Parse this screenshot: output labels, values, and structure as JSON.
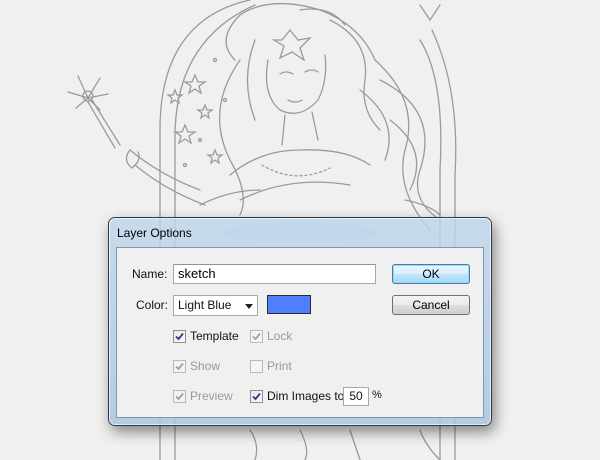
{
  "dialog": {
    "title": "Layer Options",
    "name_label": "Name:",
    "name_value": "sketch",
    "color_label": "Color:",
    "color_value": "Light Blue",
    "color_swatch": "#4f7fff",
    "ok_label": "OK",
    "cancel_label": "Cancel",
    "options": {
      "template": {
        "label": "Template",
        "checked": true,
        "enabled": true
      },
      "lock": {
        "label": "Lock",
        "checked": true,
        "enabled": false
      },
      "show": {
        "label": "Show",
        "checked": true,
        "enabled": false
      },
      "print": {
        "label": "Print",
        "checked": false,
        "enabled": false
      },
      "preview": {
        "label": "Preview",
        "checked": true,
        "enabled": false
      },
      "dim_images": {
        "label": "Dim Images to:",
        "checked": true,
        "enabled": true,
        "value": "50",
        "unit": "%"
      }
    }
  },
  "icons": {
    "dropdown": "chevron-down-icon",
    "checkmark": "checkmark-icon"
  }
}
